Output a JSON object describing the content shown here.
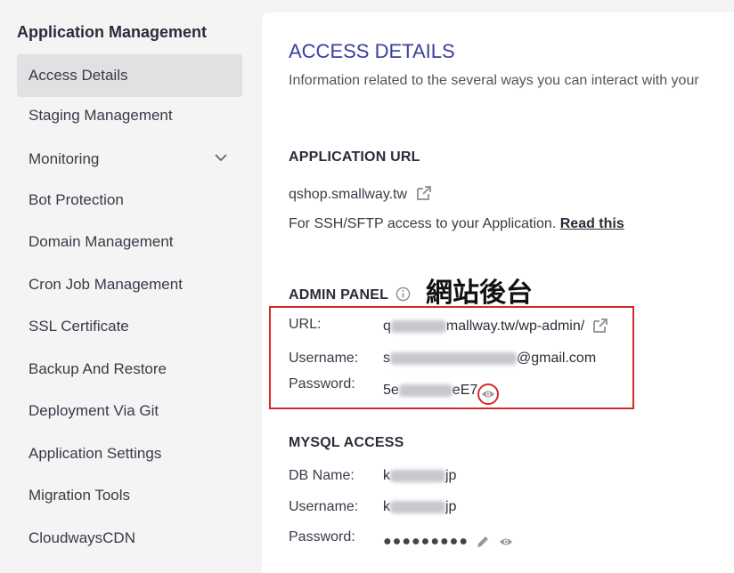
{
  "sidebar": {
    "title": "Application Management",
    "items": [
      {
        "label": "Access Details"
      },
      {
        "label": "Staging Management"
      },
      {
        "label": "Monitoring"
      },
      {
        "label": "Bot Protection"
      },
      {
        "label": "Domain Management"
      },
      {
        "label": "Cron Job Management"
      },
      {
        "label": "SSL Certificate"
      },
      {
        "label": "Backup And Restore"
      },
      {
        "label": "Deployment Via Git"
      },
      {
        "label": "Application Settings"
      },
      {
        "label": "Migration Tools"
      },
      {
        "label": "CloudwaysCDN"
      }
    ]
  },
  "main": {
    "title": "ACCESS DETAILS",
    "description": "Information related to the several ways you can interact with your",
    "app_url": {
      "heading": "APPLICATION URL",
      "url": "qshop.smallway.tw",
      "ssh_text": "For SSH/SFTP access to your Application.",
      "read_this": "Read this"
    },
    "admin_panel": {
      "heading": "ADMIN PANEL",
      "annotation": "網站後台",
      "url_label": "URL:",
      "url_prefix": "q",
      "url_suffix": "mallway.tw/wp-admin/",
      "username_label": "Username:",
      "username_prefix": "s",
      "username_suffix": "@gmail.com",
      "password_label": "Password:",
      "password_prefix": "5e",
      "password_suffix": "eE7"
    },
    "mysql": {
      "heading": "MYSQL ACCESS",
      "db_label": "DB Name:",
      "db_prefix": "k",
      "db_suffix": "jp",
      "username_label": "Username:",
      "username_prefix": "k",
      "username_suffix": "jp",
      "password_label": "Password:",
      "password_mask": "●●●●●●●●●"
    }
  },
  "colors": {
    "accent": "#3b3f9e",
    "highlight": "#d62a2a"
  }
}
